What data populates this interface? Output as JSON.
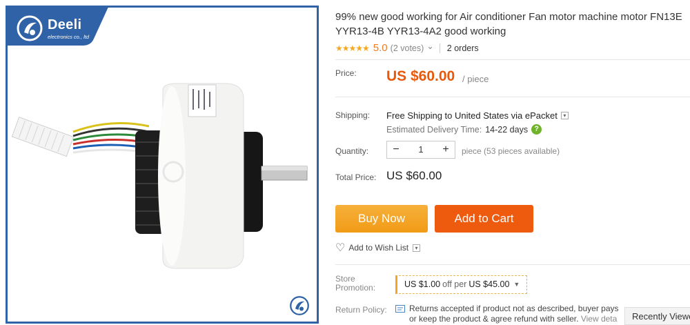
{
  "brand": {
    "name": "Deeli",
    "subtitle": "electronics co., ltd"
  },
  "product": {
    "title_line1": "99% new good working for Air conditioner Fan motor machine motor FN13E",
    "title_line2": "YYR13-4B YYR13-4A2 good working",
    "stars": "★★★★★",
    "rating": "5.0",
    "votes": "(2 votes)",
    "votes_caret": "⌄",
    "orders": "2 orders"
  },
  "price": {
    "label": "Price:",
    "value": "US $60.00",
    "unit": "/ piece"
  },
  "shipping": {
    "label": "Shipping:",
    "method": "Free Shipping to United States via ePacket",
    "delivery_label": "Estimated Delivery Time:",
    "delivery_days": "14-22 days",
    "help": "?"
  },
  "quantity": {
    "label": "Quantity:",
    "minus": "−",
    "value": "1",
    "plus": "+",
    "note": "piece (53 pieces available)"
  },
  "total": {
    "label": "Total Price:",
    "value": "US $60.00"
  },
  "buttons": {
    "buy_now": "Buy Now",
    "add_to_cart": "Add to Cart"
  },
  "wishlist": {
    "label": "Add to Wish List",
    "heart": "♡"
  },
  "promotion": {
    "label_line1": "Store",
    "label_line2": "Promotion:",
    "amount": "US $1.00",
    "off_per": "off per",
    "threshold": "US $45.00"
  },
  "return_policy": {
    "label": "Return Policy:",
    "line1": "Returns accepted if product not as described, buyer pays",
    "line2": "or keep the product & agree refund with seller.",
    "view": "View deta"
  },
  "recently_viewed": "Recently Viewe",
  "colors": {
    "frame_blue": "#2f62a6",
    "price_orange": "#e8590c",
    "buy_now": "#f3a21f",
    "add_to_cart": "#ee5a0e",
    "star": "#f6a820"
  }
}
